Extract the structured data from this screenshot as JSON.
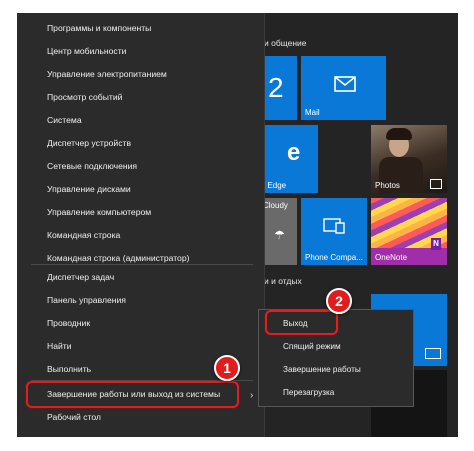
{
  "winx_menu": {
    "items": [
      "Программы и компоненты",
      "Центр мобильности",
      "Управление электропитанием",
      "Просмотр событий",
      "Система",
      "Диспетчер устройств",
      "Сетевые подключения",
      "Управление дисками",
      "Управление компьютером",
      "Командная строка",
      "Командная строка (администратор)",
      "Диспетчер задач",
      "Панель управления",
      "Проводник",
      "Найти",
      "Выполнить",
      "Завершение работы или выход из системы",
      "Рабочий стол"
    ]
  },
  "submenu": {
    "items": [
      "Выход",
      "Спящий режим",
      "Завершение работы",
      "Перезагрузка"
    ]
  },
  "start": {
    "group1_title": "и общение",
    "group2_title": "и и отдых",
    "tiles": {
      "calendar_number": "2",
      "mail": "Mail",
      "edge": "t Edge",
      "photos": "Photos",
      "weather": "Cloudy",
      "phone": "Phone Compa...",
      "onenote": "OneNote"
    }
  },
  "callouts": {
    "one": "1",
    "two": "2"
  },
  "colors": {
    "accent": "#0a78d7",
    "highlight": "#e02020"
  }
}
